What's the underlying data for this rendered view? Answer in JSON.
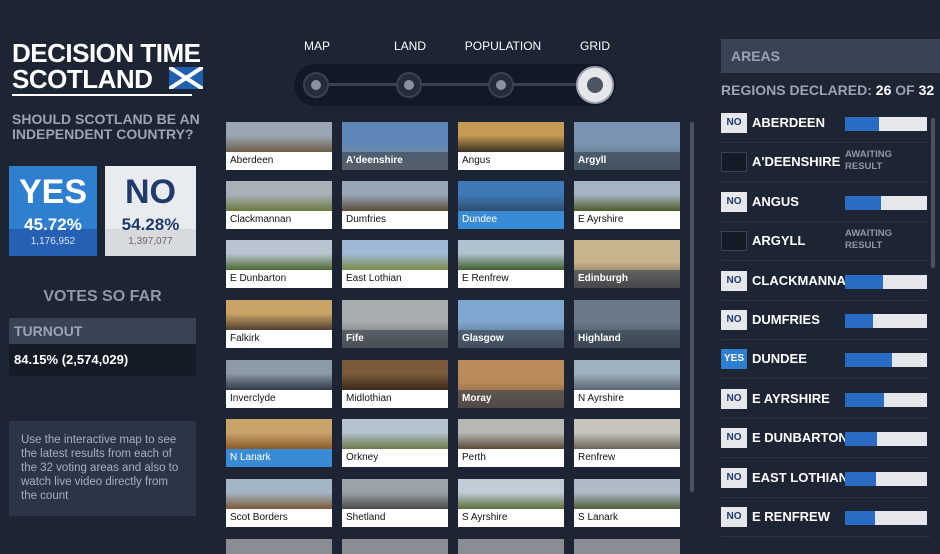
{
  "logo": {
    "line1": "DECISION TIME",
    "line2": "SCOTLAND"
  },
  "question": "SHOULD SCOTLAND BE AN INDEPENDENT COUNTRY?",
  "result": {
    "yes": {
      "label": "YES",
      "pct": "45.72%",
      "votes": "1,176,952"
    },
    "no": {
      "label": "NO",
      "pct": "54.28%",
      "votes": "1,397,077"
    }
  },
  "votes_so_far": "VOTES SO FAR",
  "turnout": {
    "label": "TURNOUT",
    "value": "84.15% (2,574,029)"
  },
  "info": "Use the interactive map to see the latest results from each of the 32 voting areas and also to watch live video directly from the count",
  "nav": {
    "tabs": [
      "MAP",
      "LAND",
      "POPULATION",
      "GRID"
    ],
    "active": "GRID"
  },
  "colors": {
    "yes": "#2f7fd0",
    "no": "#e9ecef",
    "background": "#1d2535",
    "panel": "#3a4353"
  },
  "grid": {
    "tiles": [
      {
        "name": "Aberdeen",
        "style": "normal",
        "photo": [
          "#9aa6b4",
          "#6d5f4a"
        ]
      },
      {
        "name": "A'deenshire",
        "style": "overlay",
        "photo": [
          "#5f86b8",
          "#8a8e8a"
        ]
      },
      {
        "name": "Angus",
        "style": "normal",
        "photo": [
          "#c59a52",
          "#3a2f22"
        ]
      },
      {
        "name": "Argyll",
        "style": "overlay",
        "photo": [
          "#7b93b0",
          "#4f6676"
        ]
      },
      {
        "name": "Clackmannan",
        "style": "normal",
        "photo": [
          "#a9b0b8",
          "#6b7a3e"
        ]
      },
      {
        "name": "Dumfries",
        "style": "normal",
        "photo": [
          "#98a7b6",
          "#5d4b3a"
        ]
      },
      {
        "name": "Dundee",
        "style": "selected",
        "photo": [
          "#3f7ab8",
          "#2d4d6e"
        ]
      },
      {
        "name": "E Ayrshire",
        "style": "normal",
        "photo": [
          "#a5b4c2",
          "#4e5b2c"
        ]
      },
      {
        "name": "E Dunbarton",
        "style": "normal",
        "photo": [
          "#b8c4cf",
          "#4c6a34"
        ]
      },
      {
        "name": "East Lothian",
        "style": "normal",
        "photo": [
          "#9fb8d6",
          "#7b8c4c"
        ]
      },
      {
        "name": "E Renfrew",
        "style": "normal",
        "photo": [
          "#b0c2d0",
          "#40602e"
        ]
      },
      {
        "name": "Edinburgh",
        "style": "overlay",
        "photo": [
          "#c7b48c",
          "#5b4a3a"
        ]
      },
      {
        "name": "Falkirk",
        "style": "normal",
        "photo": [
          "#c9a466",
          "#4e4030"
        ]
      },
      {
        "name": "Fife",
        "style": "overlay",
        "photo": [
          "#a7acaf",
          "#5d5a50"
        ]
      },
      {
        "name": "Glasgow",
        "style": "overlay",
        "photo": [
          "#7fa6cf",
          "#4e5a6a"
        ]
      },
      {
        "name": "Highland",
        "style": "overlay",
        "photo": [
          "#6a7a8a",
          "#3a4a52"
        ]
      },
      {
        "name": "Inverclyde",
        "style": "normal",
        "photo": [
          "#8c9aa6",
          "#2e3a46"
        ]
      },
      {
        "name": "Midlothian",
        "style": "normal",
        "photo": [
          "#7a5a3a",
          "#3a2a1c"
        ]
      },
      {
        "name": "Moray",
        "style": "overlay",
        "photo": [
          "#b98a5a",
          "#7a4a2a"
        ]
      },
      {
        "name": "N Ayrshire",
        "style": "normal",
        "photo": [
          "#9fb0bf",
          "#5a6670"
        ]
      },
      {
        "name": "N Lanark",
        "style": "selected",
        "photo": [
          "#c9a46a",
          "#8a5a2a"
        ]
      },
      {
        "name": "Orkney",
        "style": "normal",
        "photo": [
          "#b4c2cf",
          "#6b7a4a"
        ]
      },
      {
        "name": "Perth",
        "style": "normal",
        "photo": [
          "#b6b8b4",
          "#5a4a3a"
        ]
      },
      {
        "name": "Renfrew",
        "style": "normal",
        "photo": [
          "#c8c4bc",
          "#6a6458"
        ]
      },
      {
        "name": "Scot Borders",
        "style": "normal",
        "photo": [
          "#a4b6c6",
          "#7a5a3a"
        ]
      },
      {
        "name": "Shetland",
        "style": "normal",
        "photo": [
          "#9aa2aa",
          "#4a4a48"
        ]
      },
      {
        "name": "S Ayrshire",
        "style": "normal",
        "photo": [
          "#c0ccd6",
          "#5a6e3a"
        ]
      },
      {
        "name": "S Lanark",
        "style": "normal",
        "photo": [
          "#aebac6",
          "#4e5e38"
        ]
      }
    ]
  },
  "areas": {
    "title": "AREAS",
    "declared_label": "REGIONS DECLARED:",
    "declared_count": "26",
    "declared_of": "OF",
    "declared_total": "32",
    "awaiting_text": "AWAITING RESULT",
    "rows": [
      {
        "name": "ABERDEEN",
        "result": "NO",
        "yes_share": 0.41
      },
      {
        "name": "A'DEENSHIRE",
        "result": "",
        "yes_share": null
      },
      {
        "name": "ANGUS",
        "result": "NO",
        "yes_share": 0.44
      },
      {
        "name": "ARGYLL",
        "result": "",
        "yes_share": null
      },
      {
        "name": "CLACKMANNAN",
        "result": "NO",
        "yes_share": 0.46
      },
      {
        "name": "DUMFRIES",
        "result": "NO",
        "yes_share": 0.34
      },
      {
        "name": "DUNDEE",
        "result": "YES",
        "yes_share": 0.57
      },
      {
        "name": "E AYRSHIRE",
        "result": "NO",
        "yes_share": 0.47
      },
      {
        "name": "E DUNBARTON",
        "result": "NO",
        "yes_share": 0.39
      },
      {
        "name": "EAST LOTHIAN",
        "result": "NO",
        "yes_share": 0.38
      },
      {
        "name": "E RENFREW",
        "result": "NO",
        "yes_share": 0.37
      }
    ]
  }
}
